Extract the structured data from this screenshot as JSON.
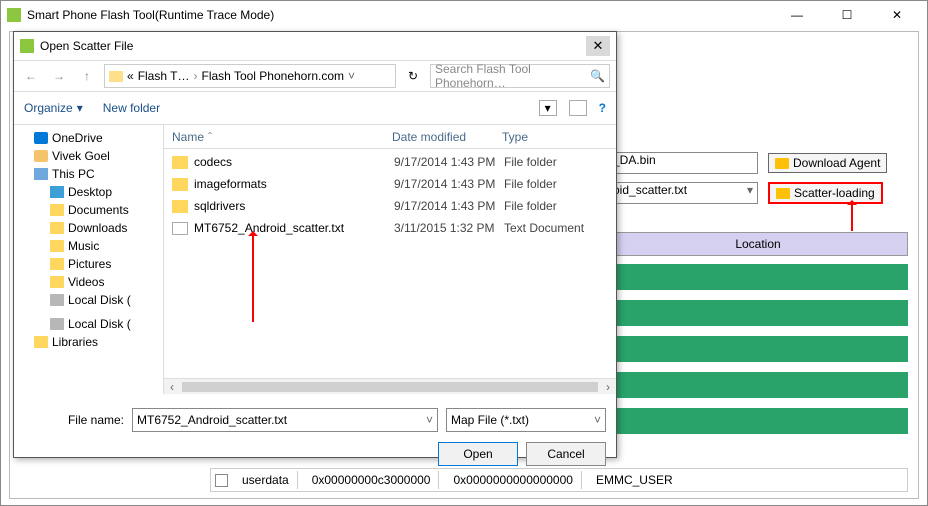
{
  "main_window": {
    "title": "Smart Phone Flash Tool(Runtime Trace Mode)",
    "da_file": "_DA.bin",
    "download_agent_btn": "Download Agent",
    "scatter_file": "oid_scatter.txt",
    "scatter_btn": "Scatter-loading",
    "location_header": "Location",
    "userdata": {
      "name": "userdata",
      "begin": "0x00000000c3000000",
      "end": "0x0000000000000000",
      "region": "EMMC_USER"
    }
  },
  "dialog": {
    "title": "Open Scatter File",
    "breadcrumb": {
      "prefix": "«",
      "seg1": "Flash T…",
      "seg2": "Flash Tool Phonehorn.com"
    },
    "search_placeholder": "Search Flash Tool Phonehorn…",
    "toolbar": {
      "organize": "Organize",
      "new_folder": "New folder"
    },
    "tree": {
      "onedrive": "OneDrive",
      "user": "Vivek Goel",
      "this_pc": "This PC",
      "desktop": "Desktop",
      "documents": "Documents",
      "downloads": "Downloads",
      "music": "Music",
      "pictures": "Pictures",
      "videos": "Videos",
      "local_c": "Local Disk (",
      "local_d": "Local Disk (",
      "libraries": "Libraries"
    },
    "columns": {
      "name": "Name",
      "date": "Date modified",
      "type": "Type"
    },
    "files": [
      {
        "name": "codecs",
        "date": "9/17/2014 1:43 PM",
        "type": "File folder",
        "kind": "folder"
      },
      {
        "name": "imageformats",
        "date": "9/17/2014 1:43 PM",
        "type": "File folder",
        "kind": "folder"
      },
      {
        "name": "sqldrivers",
        "date": "9/17/2014 1:43 PM",
        "type": "File folder",
        "kind": "folder"
      },
      {
        "name": "MT6752_Android_scatter.txt",
        "date": "3/11/2015 1:32 PM",
        "type": "Text Document",
        "kind": "txt",
        "selected": true
      }
    ],
    "file_name_label": "File name:",
    "file_name_value": "MT6752_Android_scatter.txt",
    "filter": "Map File (*.txt)",
    "open": "Open",
    "cancel": "Cancel"
  }
}
